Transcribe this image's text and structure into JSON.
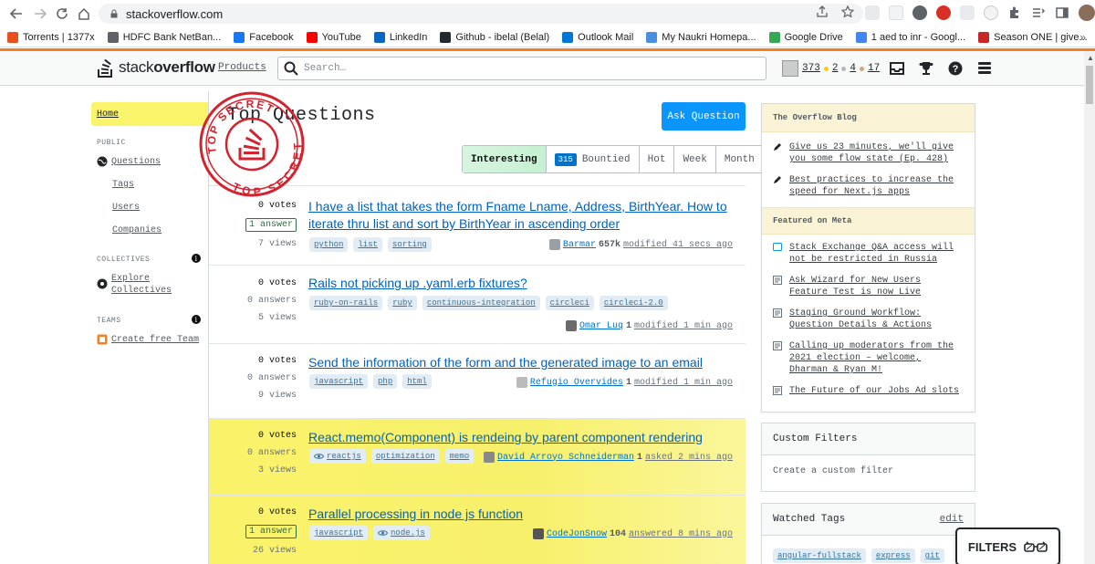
{
  "browser": {
    "url": "stackoverflow.com",
    "bookmarks": [
      {
        "label": "Torrents | 1377x",
        "color": "#e8501d"
      },
      {
        "label": "HDFC Bank NetBan...",
        "color": "#5f6368"
      },
      {
        "label": "Facebook",
        "color": "#1877f2"
      },
      {
        "label": "YouTube",
        "color": "#ff0000"
      },
      {
        "label": "LinkedIn",
        "color": "#0a66c2"
      },
      {
        "label": "Github - ibelal (Belal)",
        "color": "#24292e"
      },
      {
        "label": "Outlook Mail",
        "color": "#0078d4"
      },
      {
        "label": "My Naukri Homepa...",
        "color": "#4a90e2"
      },
      {
        "label": "Google Drive",
        "color": "#34a853"
      },
      {
        "label": "1 aed to inr - Googl...",
        "color": "#4285f4"
      },
      {
        "label": "Season ONE | give...",
        "color": "#c62828"
      }
    ],
    "more": "»"
  },
  "topbar": {
    "logo_plain": "stack",
    "logo_bold": "overflow",
    "products": "Products",
    "search_placeholder": "Search…",
    "reputation": "373",
    "gold": "2",
    "silver": "4",
    "bronze": "17"
  },
  "leftnav": {
    "home": "Home",
    "public": "PUBLIC",
    "questions": "Questions",
    "tags": "Tags",
    "users": "Users",
    "companies": "Companies",
    "collectives": "COLLECTIVES",
    "explore_1": "Explore",
    "explore_2": "Collectives",
    "teams": "TEAMS",
    "create_team": "Create free Team"
  },
  "stamp": {
    "top": "TOP SECRET",
    "bottom": "TOP SECRET"
  },
  "main": {
    "title": "Top Questions",
    "ask_button": "Ask Question",
    "tabs": {
      "interesting": "Interesting",
      "bountied_count": "315",
      "bountied": "Bountied",
      "hot": "Hot",
      "week": "Week",
      "month": "Month"
    },
    "questions": [
      {
        "votes": "0 votes",
        "answers": "1 answer",
        "views": "7 views",
        "title_1": "I have a list that takes the form Fname Lname, Address, BirthYear. How to",
        "title_2": "iterate thru list and sort by BirthYear in ascending order",
        "tags": [
          "python",
          "list",
          "sorting"
        ],
        "user": "Barmar",
        "rep": "657k",
        "when": "modified 41 secs ago"
      },
      {
        "votes": "0 votes",
        "answers": "0 answers",
        "views": "5 views",
        "title_1": "Rails not picking up .yaml.erb fixtures?",
        "tags": [
          "ruby-on-rails",
          "ruby",
          "continuous-integration",
          "circleci",
          "circleci-2.0"
        ],
        "user": "Omar Luq",
        "rep": "1",
        "when": "modified 1 min ago"
      },
      {
        "votes": "0 votes",
        "answers": "0 answers",
        "views": "9 views",
        "title_1": "Send the information of the form and the generated image to an email",
        "tags": [
          "javascript",
          "php",
          "html"
        ],
        "user": "Refugio Overvides",
        "rep": "1",
        "when": "modified 1 min ago"
      },
      {
        "votes": "0 votes",
        "answers": "0 answers",
        "views": "3 views",
        "title_1": "React.memo(Component) is rendeing by parent component rendering",
        "tags": [
          "reactjs",
          "optimization",
          "memo"
        ],
        "user": "David Arroyo Schneiderman",
        "rep": "1",
        "when": "asked 2 mins ago"
      },
      {
        "votes": "0 votes",
        "answers": "1 answer",
        "views": "26 views",
        "title_1": "Parallel processing in node js function",
        "tags": [
          "javascript",
          "node.js"
        ],
        "user": "CodeJonSnow",
        "rep": "104",
        "when": "answered 8 mins ago"
      }
    ]
  },
  "sidebar": {
    "blog_title": "The Overflow Blog",
    "blog_items": [
      "Give us 23 minutes, we'll give you some flow state (Ep. 428)",
      "Best practices to increase the speed for Next.js apps"
    ],
    "meta_title": "Featured on Meta",
    "meta_items": [
      "Stack Exchange Q&A access will not be restricted in Russia",
      "Ask Wizard for New Users Feature Test is now Live",
      "Staging Ground Workflow: Question Details & Actions",
      "Calling up moderators from the 2021 election – welcome, Dharman & Ryan M!",
      "The Future of our Jobs Ad slots"
    ],
    "custom_filters": "Custom Filters",
    "create_filter": "Create a custom filter",
    "watched_tags": "Watched Tags",
    "edit": "edit",
    "watched": [
      "angular-fullstack",
      "express",
      "git"
    ]
  },
  "filters_button": "FILTERS",
  "colors": {
    "accent": "#f48024",
    "link": "#0063bf",
    "ask": "#0a95ff",
    "highlight": "#faf46a"
  }
}
